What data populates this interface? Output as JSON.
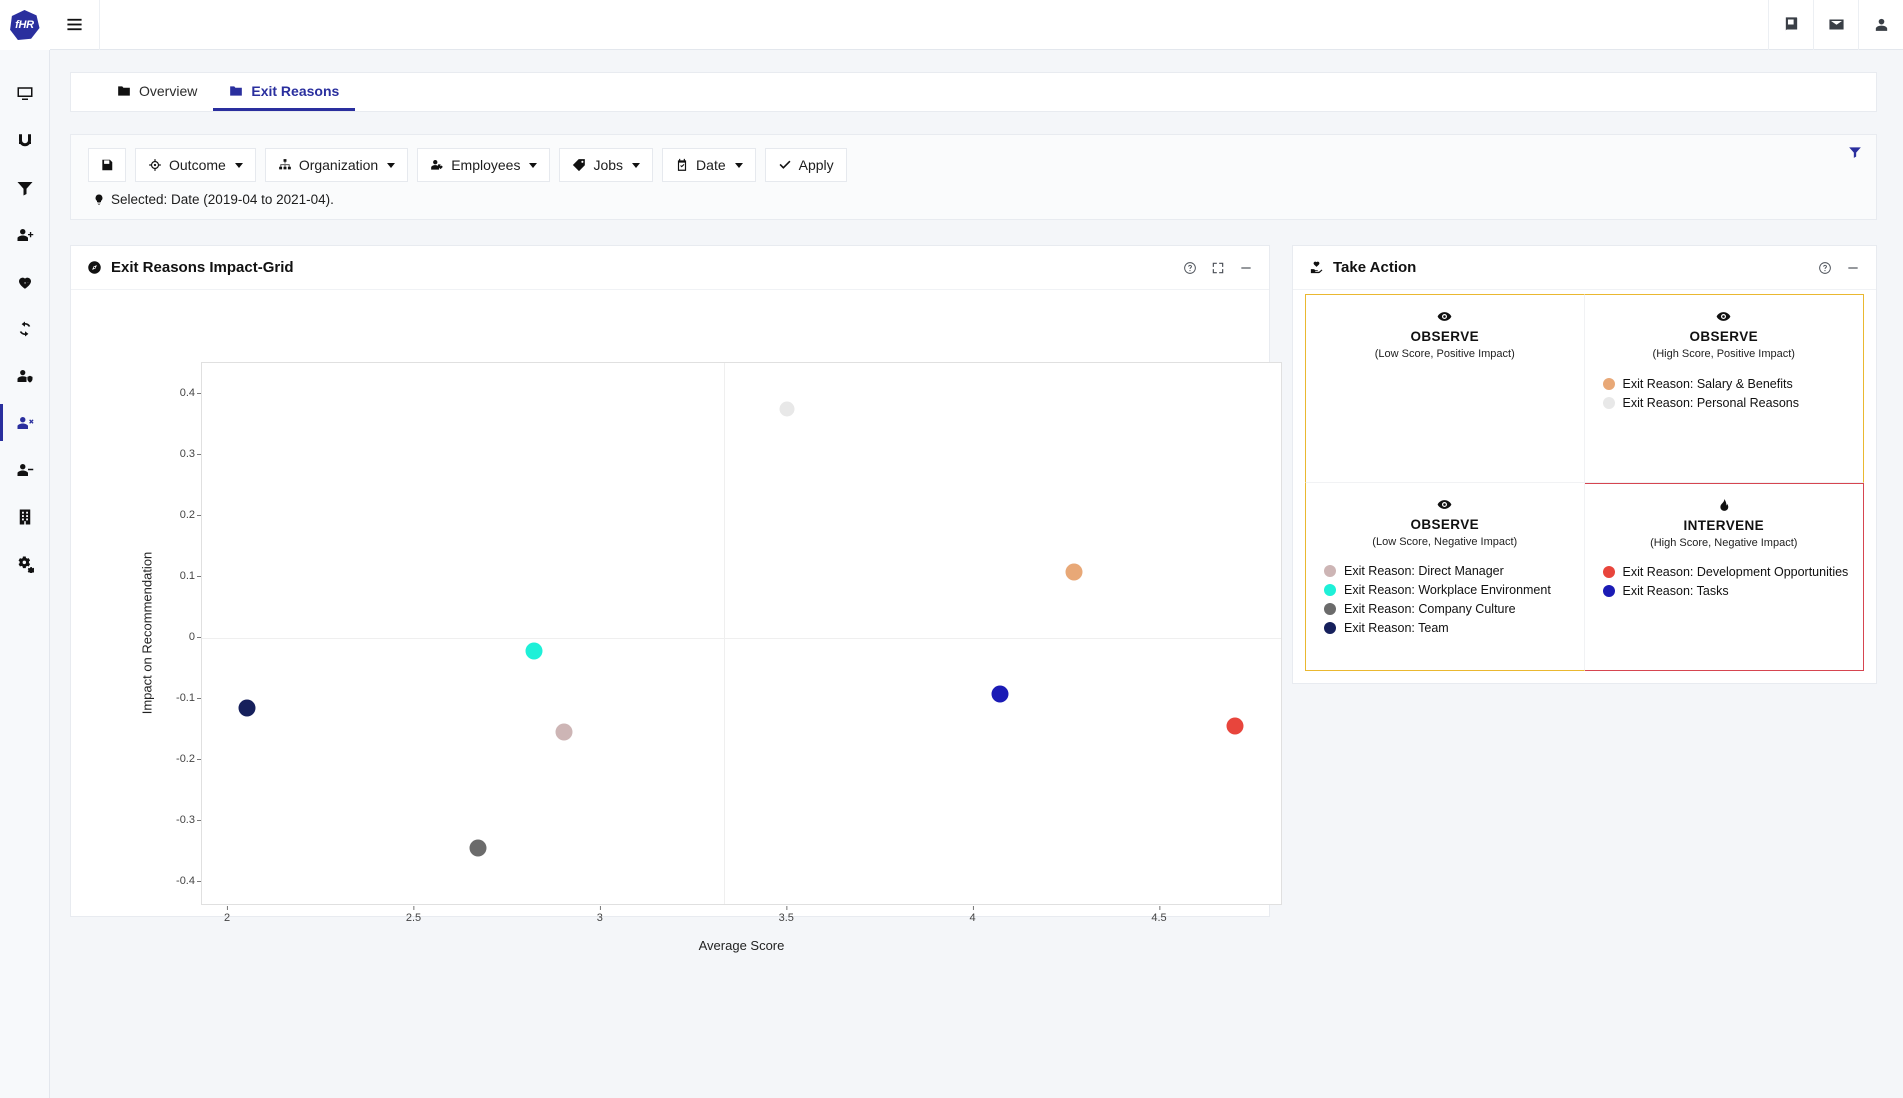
{
  "brand": {
    "label": "fHR"
  },
  "topbar": {
    "menu_icon": "hamburger-icon",
    "right_icons": [
      "book-icon",
      "envelope-icon",
      "user-icon"
    ]
  },
  "sidebar": {
    "items": [
      {
        "icon": "desktop-icon",
        "name": "sidebar-item-dashboard",
        "active": false
      },
      {
        "icon": "magnet-icon",
        "name": "sidebar-item-attraction",
        "active": false
      },
      {
        "icon": "filter-icon",
        "name": "sidebar-item-filter",
        "active": false
      },
      {
        "icon": "user-plus-icon",
        "name": "sidebar-item-recruiting",
        "active": false
      },
      {
        "icon": "heartbeat-icon",
        "name": "sidebar-item-wellbeing",
        "active": false
      },
      {
        "icon": "sync-icon",
        "name": "sidebar-item-retention",
        "active": false
      },
      {
        "icon": "user-shield-icon",
        "name": "sidebar-item-compliance",
        "active": false
      },
      {
        "icon": "user-times-icon",
        "name": "sidebar-item-exits",
        "active": true
      },
      {
        "icon": "user-minus-icon",
        "name": "sidebar-item-offboarding",
        "active": false
      },
      {
        "icon": "building-icon",
        "name": "sidebar-item-organization",
        "active": false
      },
      {
        "icon": "cogs-icon",
        "name": "sidebar-item-settings",
        "active": false
      }
    ]
  },
  "tabs": [
    {
      "label": "Overview",
      "icon": "folder-icon",
      "active": false
    },
    {
      "label": "Exit Reasons",
      "icon": "folder-icon",
      "active": true
    }
  ],
  "filters": {
    "save_icon": "save-icon",
    "buttons": [
      {
        "label": "Outcome",
        "icon": "crosshairs-icon",
        "caret": true
      },
      {
        "label": "Organization",
        "icon": "sitemap-icon",
        "caret": true
      },
      {
        "label": "Employees",
        "icon": "user-tag-icon",
        "caret": true
      },
      {
        "label": "Jobs",
        "icon": "tag-icon",
        "caret": true
      },
      {
        "label": "Date",
        "icon": "calendar-check-icon",
        "caret": true
      },
      {
        "label": "Apply",
        "icon": "check-icon",
        "caret": false
      }
    ],
    "right_icon": "filter-icon",
    "selected_text": "Selected: Date (2019-04 to 2021-04).",
    "selected_icon": "lightbulb-icon"
  },
  "chart_card": {
    "title": "Exit Reasons Impact-Grid",
    "title_icon": "compass-icon",
    "tools": [
      {
        "icon": "question-circle-icon",
        "name": "help-button"
      },
      {
        "icon": "expand-icon",
        "name": "fullscreen-button"
      },
      {
        "icon": "minus-icon",
        "name": "collapse-button"
      }
    ]
  },
  "action_card": {
    "title": "Take Action",
    "title_icon": "hand-heart-icon",
    "tools": [
      {
        "icon": "question-circle-icon",
        "name": "help-button"
      },
      {
        "icon": "minus-icon",
        "name": "collapse-button"
      }
    ],
    "quadrants": [
      {
        "id": "q-tl",
        "icon": "eye-icon",
        "title": "OBSERVE",
        "subtitle": "(Low Score, Positive Impact)",
        "items": []
      },
      {
        "id": "q-tr",
        "icon": "eye-icon",
        "title": "OBSERVE",
        "subtitle": "(High Score, Positive Impact)",
        "items": [
          {
            "label": "Exit Reason: Salary & Benefits",
            "color": "#e8a877"
          },
          {
            "label": "Exit Reason: Personal Reasons",
            "color": "#e8e8e8"
          }
        ]
      },
      {
        "id": "q-bl",
        "icon": "eye-icon",
        "title": "OBSERVE",
        "subtitle": "(Low Score, Negative Impact)",
        "items": [
          {
            "label": "Exit Reason: Direct Manager",
            "color": "#cdb5b5"
          },
          {
            "label": "Exit Reason: Workplace Environment",
            "color": "#1ef0d8"
          },
          {
            "label": "Exit Reason: Company Culture",
            "color": "#6b6b6b"
          },
          {
            "label": "Exit Reason: Team",
            "color": "#16205c"
          }
        ]
      },
      {
        "id": "q-br",
        "icon": "fire-icon",
        "title": "INTERVENE",
        "subtitle": "(High Score, Negative Impact)",
        "items": [
          {
            "label": "Exit Reason: Development Opportunities",
            "color": "#e8453c"
          },
          {
            "label": "Exit Reason: Tasks",
            "color": "#1b1bb5"
          }
        ]
      }
    ]
  },
  "chart_data": {
    "type": "scatter",
    "title": "Exit Reasons Impact-Grid",
    "xlabel": "Average Score",
    "ylabel": "Impact on Recommendation",
    "xlim": [
      1.93,
      4.83
    ],
    "ylim": [
      -0.44,
      0.45
    ],
    "xticks": [
      2,
      2.5,
      3,
      3.5,
      4,
      4.5
    ],
    "xticklabels": [
      "2",
      "2.5",
      "3",
      "3.5",
      "4",
      "4.5"
    ],
    "yticks": [
      0.4,
      0.3,
      0.2,
      0.1,
      0,
      -0.1,
      -0.2,
      -0.3,
      -0.4
    ],
    "yticklabels": [
      "0.4",
      "0.3",
      "0.2",
      "0.1",
      "0",
      "-0.1",
      "-0.2",
      "-0.3",
      "-0.4"
    ],
    "grid": true,
    "quadrant_lines": {
      "x": 3.33,
      "y": 0
    },
    "legend": "none",
    "points": [
      {
        "label": "Exit Reason: Team",
        "x": 2.05,
        "y": -0.115,
        "color": "#16205c"
      },
      {
        "label": "Exit Reason: Workplace Environment",
        "x": 2.82,
        "y": -0.022,
        "color": "#1ef0d8"
      },
      {
        "label": "Exit Reason: Direct Manager",
        "x": 2.9,
        "y": -0.155,
        "color": "#cdb5b5"
      },
      {
        "label": "Exit Reason: Company Culture",
        "x": 2.67,
        "y": -0.345,
        "color": "#6b6b6b"
      },
      {
        "label": "Exit Reason: Personal Reasons",
        "x": 3.5,
        "y": 0.375,
        "color": "#e8e8e8"
      },
      {
        "label": "Exit Reason: Salary & Benefits",
        "x": 4.27,
        "y": 0.108,
        "color": "#e8a877"
      },
      {
        "label": "Exit Reason: Tasks",
        "x": 4.07,
        "y": -0.092,
        "color": "#1b1bb5"
      },
      {
        "label": "Exit Reason: Development Opportunities",
        "x": 4.7,
        "y": -0.145,
        "color": "#e8453c"
      }
    ]
  }
}
